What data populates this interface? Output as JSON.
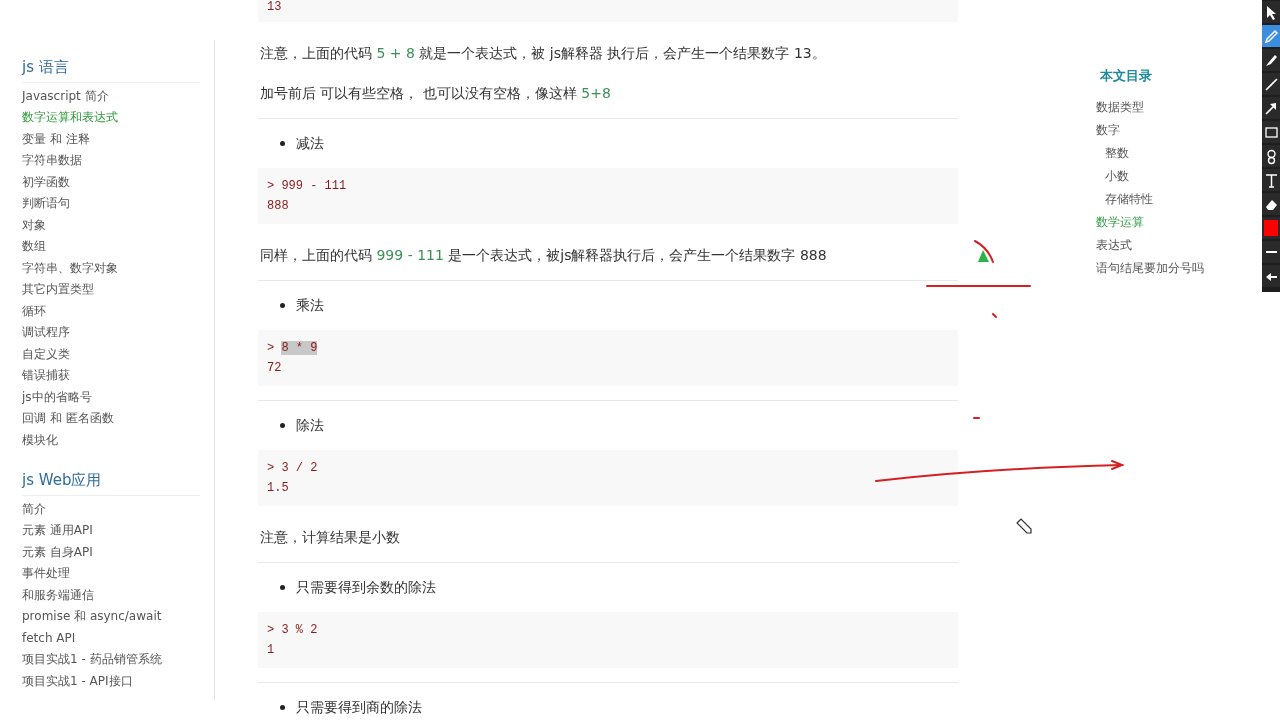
{
  "sidebar": {
    "sections": [
      {
        "title": "js 语言",
        "items": [
          {
            "label": "Javascript 简介",
            "selected": false
          },
          {
            "label": "数字运算和表达式",
            "selected": true
          },
          {
            "label": "变量 和 注释",
            "selected": false
          },
          {
            "label": "字符串数据",
            "selected": false
          },
          {
            "label": "初学函数",
            "selected": false
          },
          {
            "label": "判断语句",
            "selected": false
          },
          {
            "label": "对象",
            "selected": false
          },
          {
            "label": "数组",
            "selected": false
          },
          {
            "label": "字符串、数字对象",
            "selected": false
          },
          {
            "label": "其它内置类型",
            "selected": false
          },
          {
            "label": "循环",
            "selected": false
          },
          {
            "label": "调试程序",
            "selected": false
          },
          {
            "label": "自定义类",
            "selected": false
          },
          {
            "label": "错误捕获",
            "selected": false
          },
          {
            "label": "js中的省略号",
            "selected": false
          },
          {
            "label": "回调 和 匿名函数",
            "selected": false
          },
          {
            "label": "模块化",
            "selected": false
          }
        ]
      },
      {
        "title": "js Web应用",
        "items": [
          {
            "label": "简介",
            "selected": false
          },
          {
            "label": "元素 通用API",
            "selected": false
          },
          {
            "label": "元素 自身API",
            "selected": false
          },
          {
            "label": "事件处理",
            "selected": false
          },
          {
            "label": "和服务端通信",
            "selected": false
          },
          {
            "label": "promise 和 async/await",
            "selected": false
          },
          {
            "label": "fetch API",
            "selected": false
          },
          {
            "label": "项目实战1 - 药品销管系统",
            "selected": false
          },
          {
            "label": "项目实战1 - API接口",
            "selected": false
          }
        ]
      }
    ]
  },
  "content": {
    "blocks": [
      {
        "kind": "code",
        "output": "13"
      },
      {
        "kind": "paragraph",
        "segments": [
          {
            "text": "注意，上面的代码 "
          },
          {
            "text": "5 + 8",
            "kind": "code"
          },
          {
            "text": " 就是一个表达式，被 js解释器 执行后，会产生一个结果数字 13。"
          }
        ]
      },
      {
        "kind": "paragraph",
        "segments": [
          {
            "text": "加号前后 可以有些空格， 也可以没有空格，像这样 "
          },
          {
            "text": "5+8",
            "kind": "code"
          }
        ]
      },
      {
        "kind": "bullet",
        "text": "减法"
      },
      {
        "kind": "code",
        "prompt": ">",
        "input": "999 - 111",
        "input_selected": false,
        "output": "888"
      },
      {
        "kind": "paragraph",
        "segments": [
          {
            "text": "同样，上面的代码 "
          },
          {
            "text": "999 - 111",
            "kind": "code"
          },
          {
            "text": " 是一个表达式，被js解释器执行后，会产生一个结果数字 888"
          }
        ]
      },
      {
        "kind": "bullet",
        "text": "乘法"
      },
      {
        "kind": "code",
        "prompt": ">",
        "input": "8 * 9",
        "input_selected": true,
        "output": "72"
      },
      {
        "kind": "bullet",
        "text": "除法"
      },
      {
        "kind": "code",
        "prompt": ">",
        "input": "3 / 2",
        "input_selected": false,
        "output": "1.5"
      },
      {
        "kind": "paragraph",
        "segments": [
          {
            "text": "注意，计算结果是小数"
          }
        ]
      },
      {
        "kind": "bullet",
        "text": "只需要得到余数的除法"
      },
      {
        "kind": "code",
        "prompt": ">",
        "input": "3 % 2",
        "input_selected": false,
        "output": "1"
      },
      {
        "kind": "bullet",
        "text": "只需要得到商的除法"
      }
    ]
  },
  "toc": {
    "title": "本文目录",
    "items": [
      {
        "label": "数据类型",
        "selected": false
      },
      {
        "label": "数字",
        "selected": false,
        "children": [
          {
            "label": "整数",
            "selected": false
          },
          {
            "label": "小数",
            "selected": false
          },
          {
            "label": "存储特性",
            "selected": false
          }
        ]
      },
      {
        "label": "数学运算",
        "selected": true
      },
      {
        "label": "表达式",
        "selected": false
      },
      {
        "label": "语句结尾要加分号吗",
        "selected": false
      }
    ]
  },
  "toolbar": {
    "tools": [
      {
        "kind": "cursor",
        "selected": false
      },
      {
        "kind": "pen",
        "selected": true
      },
      {
        "kind": "marker",
        "selected": false
      },
      {
        "kind": "line",
        "selected": false
      },
      {
        "kind": "arrow",
        "selected": false
      },
      {
        "kind": "rect",
        "selected": false
      },
      {
        "kind": "counter",
        "selected": false
      },
      {
        "kind": "text",
        "selected": false
      },
      {
        "kind": "eraser",
        "selected": false
      },
      {
        "kind": "color",
        "selected": false,
        "color": "#ff0000"
      },
      {
        "kind": "thickness",
        "selected": false
      },
      {
        "kind": "back",
        "selected": false
      }
    ]
  }
}
